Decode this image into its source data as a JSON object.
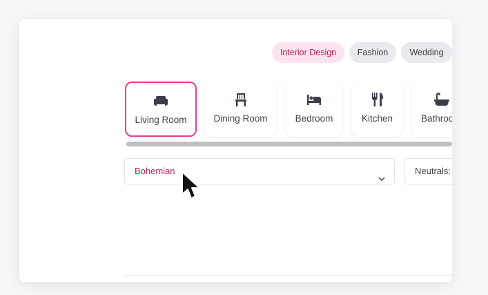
{
  "categories": {
    "chips": [
      {
        "label": "Interior Design",
        "active": true
      },
      {
        "label": "Fashion",
        "active": false
      },
      {
        "label": "Wedding",
        "active": false
      }
    ]
  },
  "rooms": {
    "items": [
      {
        "label": "Living Room",
        "icon": "sofa-icon",
        "selected": true
      },
      {
        "label": "Dining Room",
        "icon": "chair-icon",
        "selected": false
      },
      {
        "label": "Bedroom",
        "icon": "bed-icon",
        "selected": false
      },
      {
        "label": "Kitchen",
        "icon": "utensils-icon",
        "selected": false
      },
      {
        "label": "Bathroo",
        "icon": "bathtub-icon",
        "selected": false
      }
    ]
  },
  "filters": {
    "style_value": "Bohemian",
    "palette_value": "Neutrals:"
  },
  "colors": {
    "accent": "#e83e8c",
    "accent_text": "#c2185b",
    "chip_active_bg": "#fde3ef"
  }
}
